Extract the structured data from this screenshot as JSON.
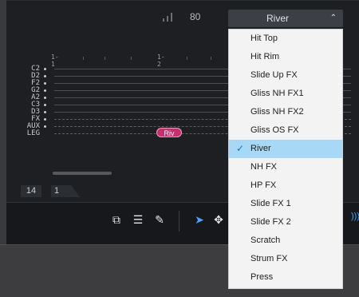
{
  "header": {
    "velocity_value": "80"
  },
  "ruler": {
    "marks": [
      "1-1",
      "1-2"
    ]
  },
  "rows": [
    "C2",
    "D2",
    "F2",
    "G2",
    "A2",
    "C3",
    "D3",
    "FX",
    "AUX",
    "LEG"
  ],
  "note": {
    "label": "Riv"
  },
  "footer": {
    "bar_number": "14",
    "flag_number": "1"
  },
  "articulation": {
    "selected": "River",
    "options": [
      "Hit Top",
      "Hit Rim",
      "Slide Up FX",
      "Gliss NH FX1",
      "Gliss NH FX2",
      "Gliss OS FX",
      "River",
      "NH FX",
      "HP FX",
      "Slide FX 1",
      "Slide FX 2",
      "Scratch",
      "Strum FX",
      "Press"
    ]
  },
  "toolbar": {
    "icons": [
      "copy-icon",
      "list-icon",
      "edit-icon",
      "pointer-icon",
      "move-icon"
    ]
  },
  "colors": {
    "accent": "#4aa3ff",
    "note": "#c2306e",
    "selection": "#a7d8f5"
  }
}
